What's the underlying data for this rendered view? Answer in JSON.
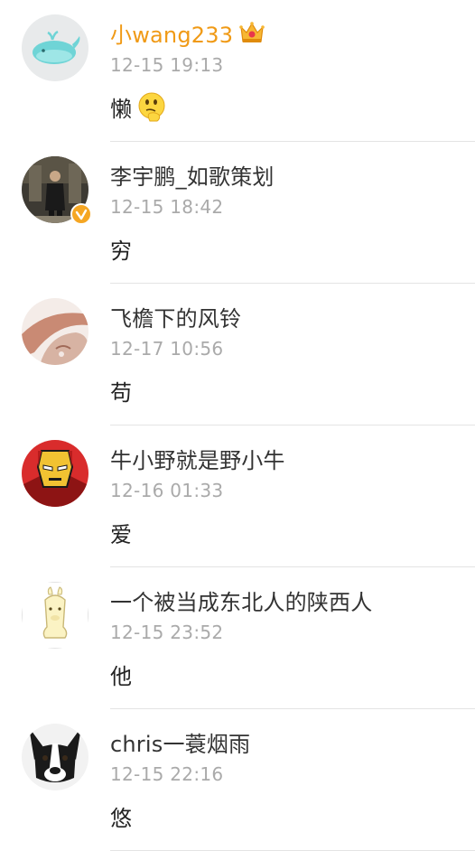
{
  "comments": [
    {
      "name": "小wang233",
      "time": "12-15 19:13",
      "text": "懒",
      "vip": true,
      "emoji": "thinking-face-icon",
      "avatar": "whale-avatar"
    },
    {
      "name": "李宇鹏_如歌策划",
      "time": "12-15 18:42",
      "text": "穷",
      "verified": true,
      "avatar": "photo-person-avatar"
    },
    {
      "name": "飞檐下的风铃",
      "time": "12-17 10:56",
      "text": "苟",
      "avatar": "pink-photo-avatar"
    },
    {
      "name": "牛小野就是野小牛",
      "time": "12-16 01:33",
      "text": "爱",
      "avatar": "iron-man-avatar"
    },
    {
      "name": "一个被当成东北人的陕西人",
      "time": "12-15 23:52",
      "text": "他",
      "avatar": "alpaca-avatar"
    },
    {
      "name": "chris一蓑烟雨",
      "time": "12-15 22:16",
      "text": "悠",
      "avatar": "bulldog-avatar"
    }
  ],
  "colors": {
    "vip_name": "#f09a16",
    "name": "#333333",
    "time": "#aaaaaa",
    "divider": "#e4e4e4",
    "verified_badge": "#f5a623"
  }
}
